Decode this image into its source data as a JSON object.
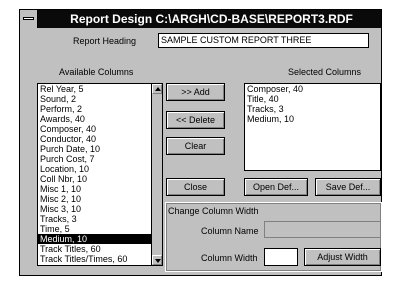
{
  "window": {
    "title": "Report Design C:\\ARGH\\CD-BASE\\REPORT3.RDF"
  },
  "report_heading": {
    "label": "Report Heading",
    "value": "SAMPLE CUSTOM REPORT THREE"
  },
  "available": {
    "label": "Available Columns",
    "items": [
      "Rel Year, 5",
      "Sound, 2",
      "Perform, 2",
      "Awards, 40",
      "Composer, 40",
      "Conductor, 40",
      "Purch Date, 10",
      "Purch Cost, 7",
      "Location, 10",
      "Coll Nbr, 10",
      "Misc 1, 10",
      "Misc 2, 10",
      "Misc 3, 10",
      "Tracks, 3",
      "Time, 5",
      "Medium, 10",
      "Track Titles, 60",
      "Track Titles/Times, 60"
    ],
    "selected_index": 15
  },
  "selected": {
    "label": "Selected Columns",
    "items": [
      "Composer, 40",
      "Title, 40",
      "Tracks, 3",
      "Medium, 10"
    ]
  },
  "buttons": {
    "add": ">> Add",
    "delete": "<< Delete",
    "clear": "Clear",
    "close": "Close",
    "open_def": "Open Def...",
    "save_def": "Save Def...",
    "adjust_width": "Adjust Width"
  },
  "change_width": {
    "legend": "Change Column Width",
    "name_label": "Column Name",
    "name_value": "",
    "width_label": "Column Width",
    "width_value": ""
  }
}
